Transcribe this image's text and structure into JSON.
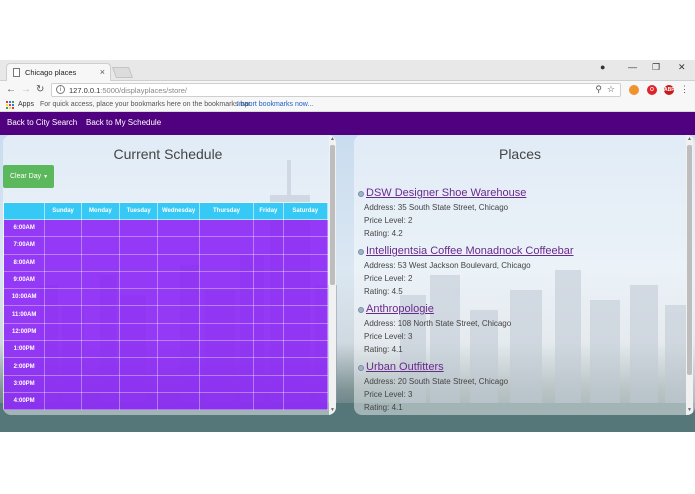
{
  "browser": {
    "tab_title": "Chicago places",
    "tab_close": "×",
    "url_host": "127.0.0.1",
    "url_path": ":5000/displayplaces/store/",
    "bookmarks": {
      "apps_label": "Apps",
      "hint": "For quick access, place your bookmarks here on the bookmarks bar.",
      "import_link": "Import bookmarks now..."
    },
    "extensions": [
      {
        "icon": "orange-circle-extension-icon",
        "label": "",
        "color": "#f0932b"
      },
      {
        "icon": "opera-extension-icon",
        "label": "O",
        "color": "#e0232b"
      },
      {
        "icon": "adblock-extension-icon",
        "label": "ABP",
        "color": "#c71a1a"
      }
    ]
  },
  "nav": {
    "link_city_search": "Back to City Search",
    "link_my_schedule": "Back to My Schedule",
    "bg_color": "#4f017f"
  },
  "schedule": {
    "title": "Current Schedule",
    "clear_day_button": "Clear Day",
    "days": [
      "Sunday",
      "Monday",
      "Tuesday",
      "Wednesday",
      "Thursday",
      "Friday",
      "Saturday"
    ],
    "times": [
      "6:00AM",
      "7:00AM",
      "8:00AM",
      "9:00AM",
      "10:00AM",
      "11:00AM",
      "12:00PM",
      "1:00PM",
      "2:00PM",
      "3:00PM",
      "4:00PM"
    ],
    "header_color": "#36c9f5",
    "cell_color": "#861cf6"
  },
  "places": {
    "title": "Places",
    "items": [
      {
        "name": "DSW Designer Shoe Warehouse",
        "address": "Address: 35 South State Street, Chicago",
        "price": "Price Level: 2",
        "rating": "Rating: 4.2"
      },
      {
        "name": "Intelligentsia Coffee Monadnock Coffeebar",
        "address": "Address: 53 West Jackson Boulevard, Chicago",
        "price": "Price Level: 2",
        "rating": "Rating: 4.5"
      },
      {
        "name": "Anthropologie",
        "address": "Address: 108 North State Street, Chicago",
        "price": "Price Level: 3",
        "rating": "Rating: 4.1"
      },
      {
        "name": "Urban Outfitters",
        "address": "Address: 20 South State Street, Chicago",
        "price": "Price Level: 3",
        "rating": "Rating: 4.1"
      }
    ]
  }
}
